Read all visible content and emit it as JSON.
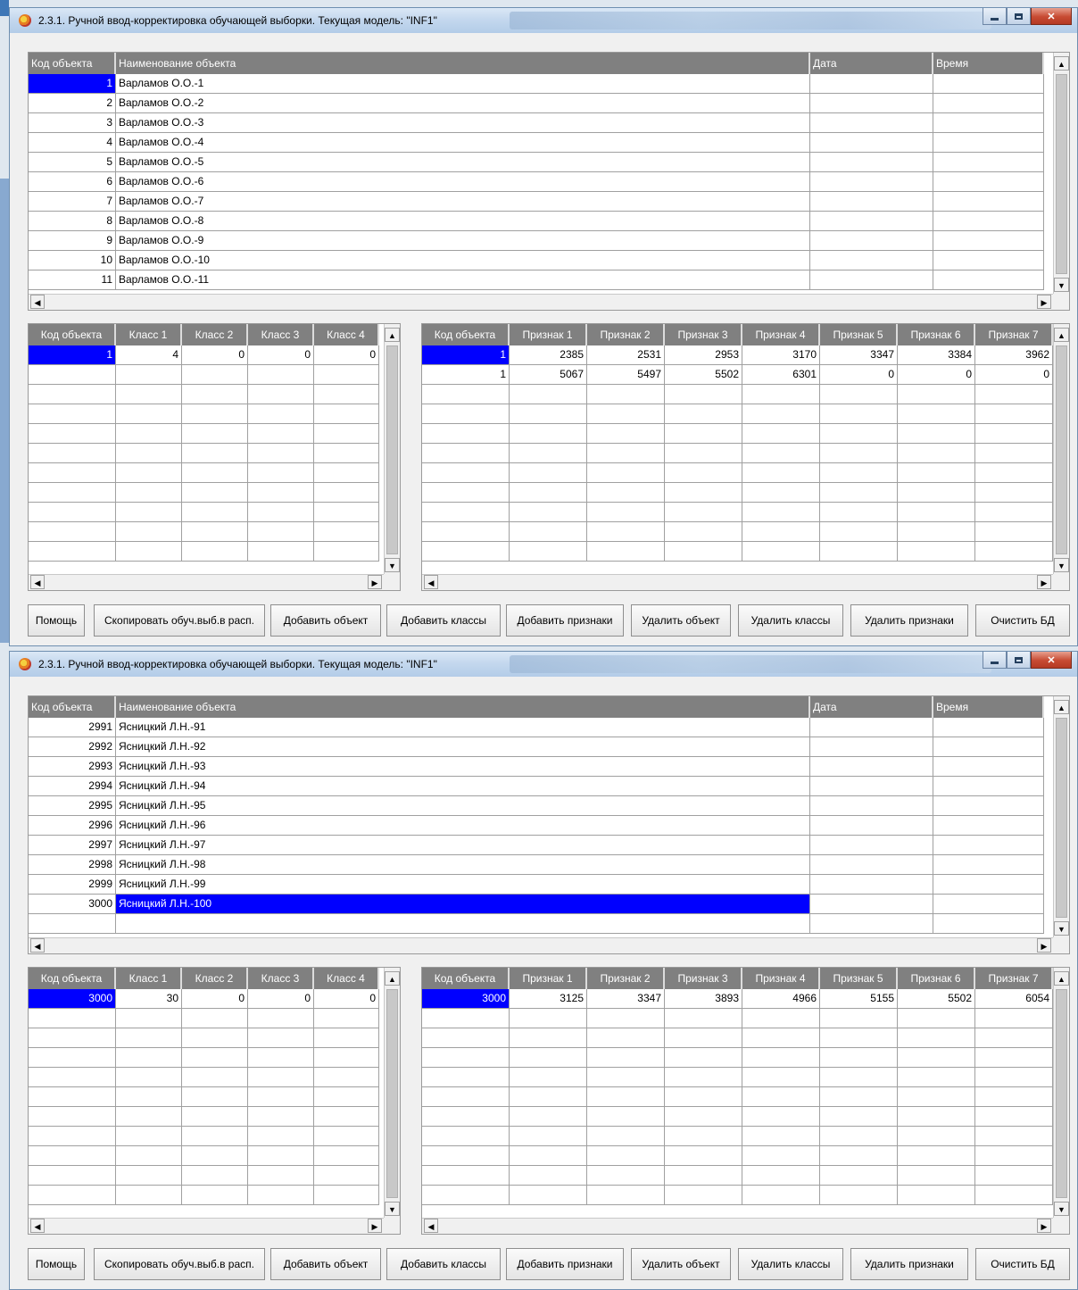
{
  "windows": [
    {
      "title": "2.3.1. Ручной ввод-корректировка обучающей выборки. Текущая модель: \"INF1\"",
      "objects": {
        "headers": [
          "Код объекта",
          "Наименование объекта",
          "Дата",
          "Время"
        ],
        "rows": [
          [
            "1",
            "Варламов О.О.-1",
            "",
            ""
          ],
          [
            "2",
            "Варламов О.О.-2",
            "",
            ""
          ],
          [
            "3",
            "Варламов О.О.-3",
            "",
            ""
          ],
          [
            "4",
            "Варламов О.О.-4",
            "",
            ""
          ],
          [
            "5",
            "Варламов О.О.-5",
            "",
            ""
          ],
          [
            "6",
            "Варламов О.О.-6",
            "",
            ""
          ],
          [
            "7",
            "Варламов О.О.-7",
            "",
            ""
          ],
          [
            "8",
            "Варламов О.О.-8",
            "",
            ""
          ],
          [
            "9",
            "Варламов О.О.-9",
            "",
            ""
          ],
          [
            "10",
            "Варламов О.О.-10",
            "",
            ""
          ],
          [
            "11",
            "Варламов О.О.-11",
            "",
            ""
          ]
        ]
      },
      "classes": {
        "headers": [
          "Код объекта",
          "Класс 1",
          "Класс 2",
          "Класс 3",
          "Класс 4"
        ],
        "rows": [
          [
            "1",
            "4",
            "0",
            "0",
            "0"
          ]
        ]
      },
      "features": {
        "headers": [
          "Код объекта",
          "Признак 1",
          "Признак 2",
          "Признак 3",
          "Признак 4",
          "Признак 5",
          "Признак 6",
          "Признак 7"
        ],
        "rows": [
          [
            "1",
            "2385",
            "2531",
            "2953",
            "3170",
            "3347",
            "3384",
            "3962"
          ],
          [
            "1",
            "5067",
            "5497",
            "5502",
            "6301",
            "0",
            "0",
            "0"
          ]
        ]
      }
    },
    {
      "title": "2.3.1. Ручной ввод-корректировка обучающей выборки. Текущая модель: \"INF1\"",
      "objects": {
        "headers": [
          "Код объекта",
          "Наименование объекта",
          "Дата",
          "Время"
        ],
        "rows": [
          [
            "2991",
            "Ясницкий Л.Н.-91",
            "",
            ""
          ],
          [
            "2992",
            "Ясницкий Л.Н.-92",
            "",
            ""
          ],
          [
            "2993",
            "Ясницкий Л.Н.-93",
            "",
            ""
          ],
          [
            "2994",
            "Ясницкий Л.Н.-94",
            "",
            ""
          ],
          [
            "2995",
            "Ясницкий Л.Н.-95",
            "",
            ""
          ],
          [
            "2996",
            "Ясницкий Л.Н.-96",
            "",
            ""
          ],
          [
            "2997",
            "Ясницкий Л.Н.-97",
            "",
            ""
          ],
          [
            "2998",
            "Ясницкий Л.Н.-98",
            "",
            ""
          ],
          [
            "2999",
            "Ясницкий Л.Н.-99",
            "",
            ""
          ],
          [
            "3000",
            "Ясницкий Л.Н.-100",
            "",
            ""
          ],
          [
            "",
            "",
            "",
            ""
          ]
        ]
      },
      "classes": {
        "headers": [
          "Код объекта",
          "Класс 1",
          "Класс 2",
          "Класс 3",
          "Класс 4"
        ],
        "rows": [
          [
            "3000",
            "30",
            "0",
            "0",
            "0"
          ]
        ]
      },
      "features": {
        "headers": [
          "Код объекта",
          "Признак 1",
          "Признак 2",
          "Признак 3",
          "Признак 4",
          "Признак 5",
          "Признак 6",
          "Признак 7"
        ],
        "rows": [
          [
            "3000",
            "3125",
            "3347",
            "3893",
            "4966",
            "5155",
            "5502",
            "6054"
          ]
        ]
      }
    }
  ],
  "buttons": [
    "Помощь",
    "Скопировать обуч.выб.в расп.",
    "Добавить объект",
    "Добавить классы",
    "Добавить признаки",
    "Удалить объект",
    "Удалить классы",
    "Удалить признаки",
    "Очистить БД"
  ],
  "icons": {
    "app": "app-logo-icon",
    "minimize": "minimize-icon",
    "maximize": "maximize-icon",
    "close": "close-icon"
  },
  "colors": {
    "selection": "#0000ff",
    "header": "#808080",
    "titlebar": "#c4d8ee"
  }
}
